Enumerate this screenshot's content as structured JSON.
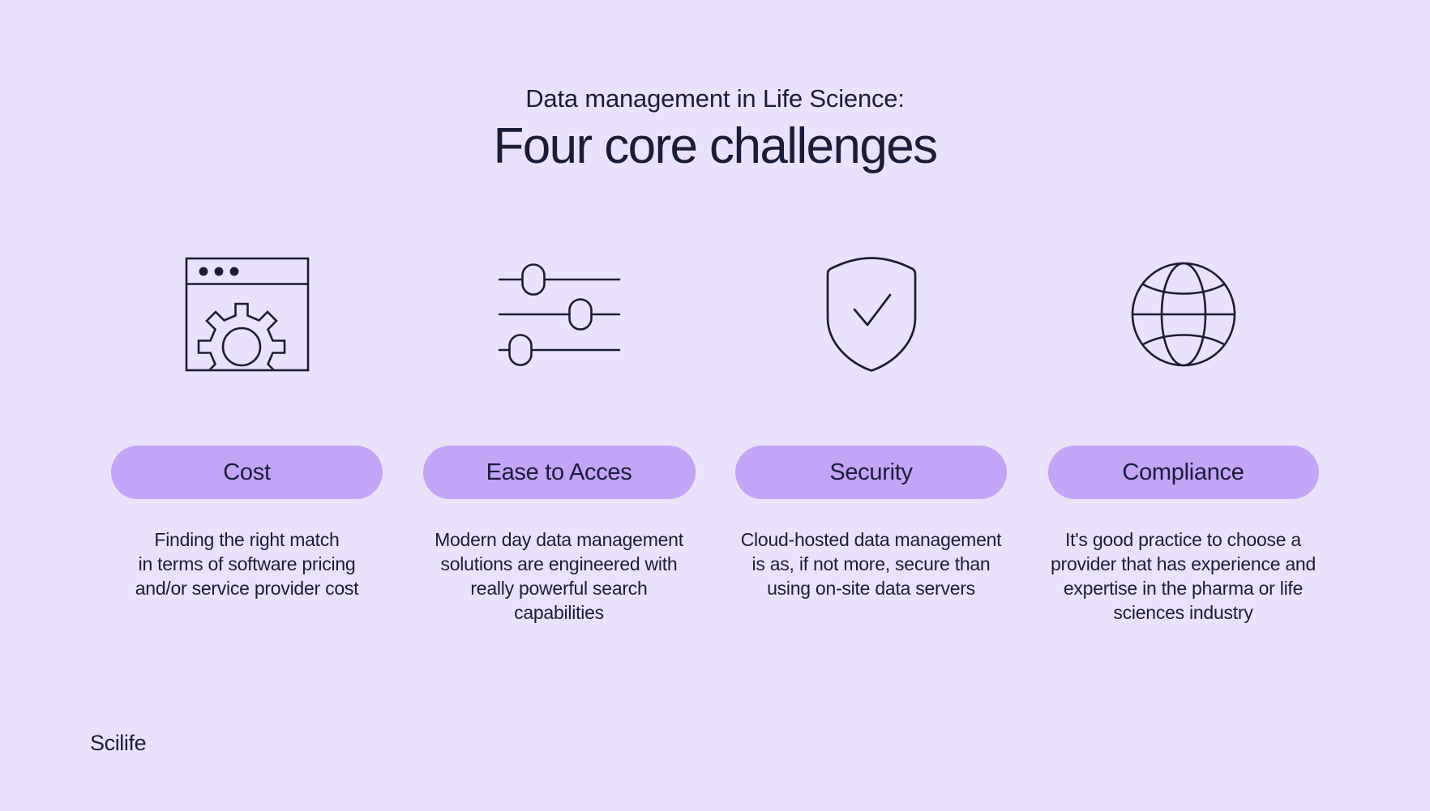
{
  "background_color": "#eae2fa",
  "text_color": "#1b1c3b",
  "accent_color": "#c3a4f7",
  "header": {
    "eyebrow": "Data management in Life Science:",
    "headline": "Four core challenges"
  },
  "columns": [
    {
      "icon": "browser-gear-icon",
      "pill_label": "Cost",
      "description": "Finding the right match\nin terms of software pricing\nand/or service provider cost"
    },
    {
      "icon": "sliders-icon",
      "pill_label": "Ease to Acces",
      "description": "Modern day data management\nsolutions are engineered with\nreally powerful search\ncapabilities"
    },
    {
      "icon": "shield-check-icon",
      "pill_label": "Security",
      "description": "Cloud-hosted data management\nis as, if not more, secure than\nusing on-site data servers"
    },
    {
      "icon": "globe-icon",
      "pill_label": "Compliance",
      "description": "It's good practice to choose a\nprovider that has experience and\nexpertise in the pharma or life\nsciences industry"
    }
  ],
  "footer": {
    "logo": "Scilife"
  }
}
